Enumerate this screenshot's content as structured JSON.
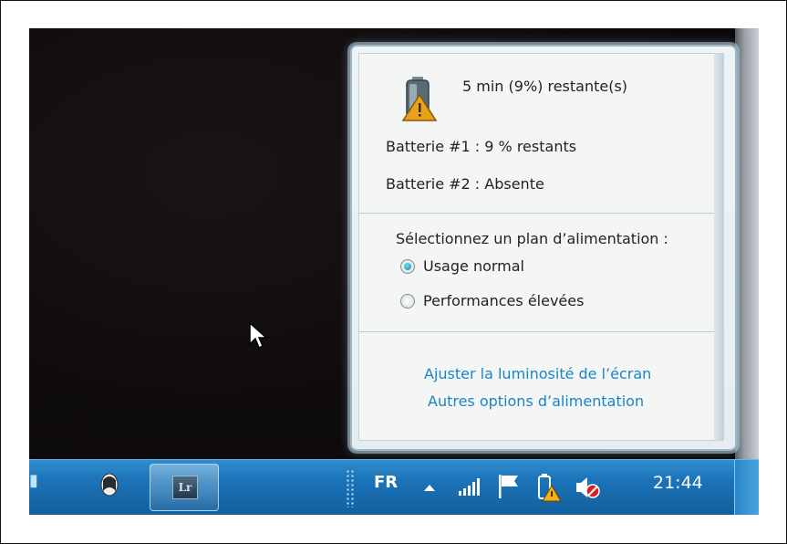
{
  "popup": {
    "status": "5 min (9%) restante(s)",
    "battery1": "Batterie #1 : 9 % restants",
    "battery2": "Batterie #2 : Absente",
    "plan_heading": "Sélectionnez un plan d’alimentation :",
    "plans": [
      {
        "label": "Usage normal",
        "selected": true
      },
      {
        "label": "Performances élevées",
        "selected": false
      }
    ],
    "links": {
      "brightness": "Ajuster la luminosité de l’écran",
      "more_options": "Autres options d’alimentation"
    }
  },
  "taskbar": {
    "language": "FR",
    "time": "21:44",
    "lightroom_label": "Lr",
    "tray_icons": [
      "show-hidden-icons-arrow",
      "network-signal-icon",
      "action-center-flag-icon",
      "battery-warning-icon",
      "volume-muted-icon"
    ]
  },
  "colors": {
    "link": "#1a85c6",
    "taskbar": "#1c74b8",
    "radio_selected": "#1687a8"
  }
}
